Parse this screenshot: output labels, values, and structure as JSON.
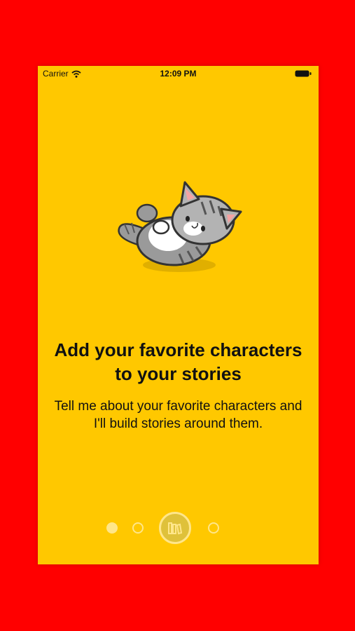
{
  "status_bar": {
    "carrier": "Carrier",
    "time": "12:09 PM"
  },
  "onboarding": {
    "title": "Add your favorite characters\nto your stories",
    "subtitle": "Tell me about your favorite characters and\nI'll build stories around them.",
    "illustration": "cat-rolling-icon"
  },
  "page_indicator": {
    "total": 4,
    "current_icon": "books-icon"
  },
  "colors": {
    "frame": "#ff0000",
    "background": "#ffc800",
    "indicator": "#ffe68a"
  }
}
